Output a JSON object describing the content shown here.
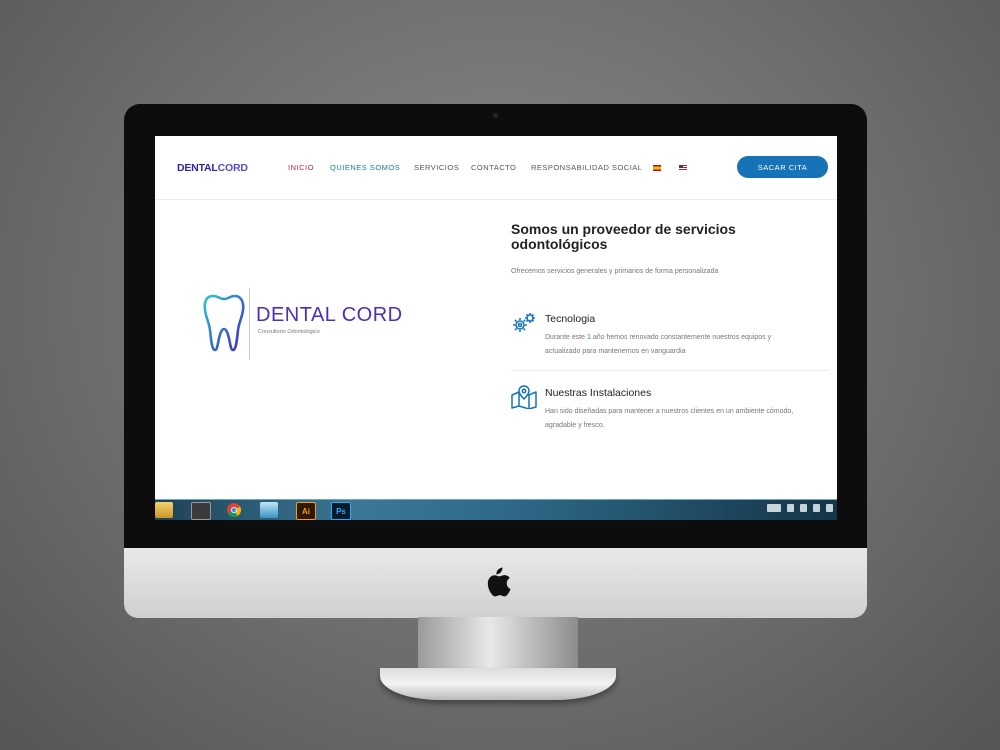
{
  "site": {
    "brand_part1": "DENTAL",
    "brand_part2": "CORD",
    "nav": [
      {
        "label": "INICIO"
      },
      {
        "label": "QUIENES SOMOS"
      },
      {
        "label": "SERVICIOS"
      },
      {
        "label": "CONTACTO"
      },
      {
        "label": "RESPONSABILIDAD SOCIAL"
      }
    ],
    "languages": [
      "es-flag-icon",
      "us-flag-icon"
    ],
    "cta_label": "SACAR CITA",
    "logo": {
      "title": "DENTAL CORD",
      "subtitle": "Consultorio Odontológico"
    },
    "headline": "Somos un proveedor de servicios odontológicos",
    "lead": "Ofrecemos servicios generales y primarios de forma personalizada",
    "features": [
      {
        "icon": "gears-icon",
        "title": "Tecnologia",
        "text_before": "Durante este ",
        "text_highlight": "1",
        "text_after": " año hemos renovado constantemente nuestros equipos y actualizado para mantenernos en vanguardia"
      },
      {
        "icon": "map-pin-icon",
        "title": "Nuestras Instalaciones",
        "text": "Han sido diseñadas para mantener a nuestros clientes en un ambiente cómodo, agradable y fresco."
      }
    ]
  },
  "taskbar": {
    "apps": [
      "explorer-icon",
      "sublime-text-icon",
      "chrome-icon",
      "network-app-icon",
      "illustrator-icon",
      "photoshop-icon"
    ],
    "illustrator_label": "Ai",
    "photoshop_label": "Ps"
  },
  "colors": {
    "brand": "#4a2fbb",
    "accent": "#1673b8",
    "active_nav": "#c2264b"
  }
}
